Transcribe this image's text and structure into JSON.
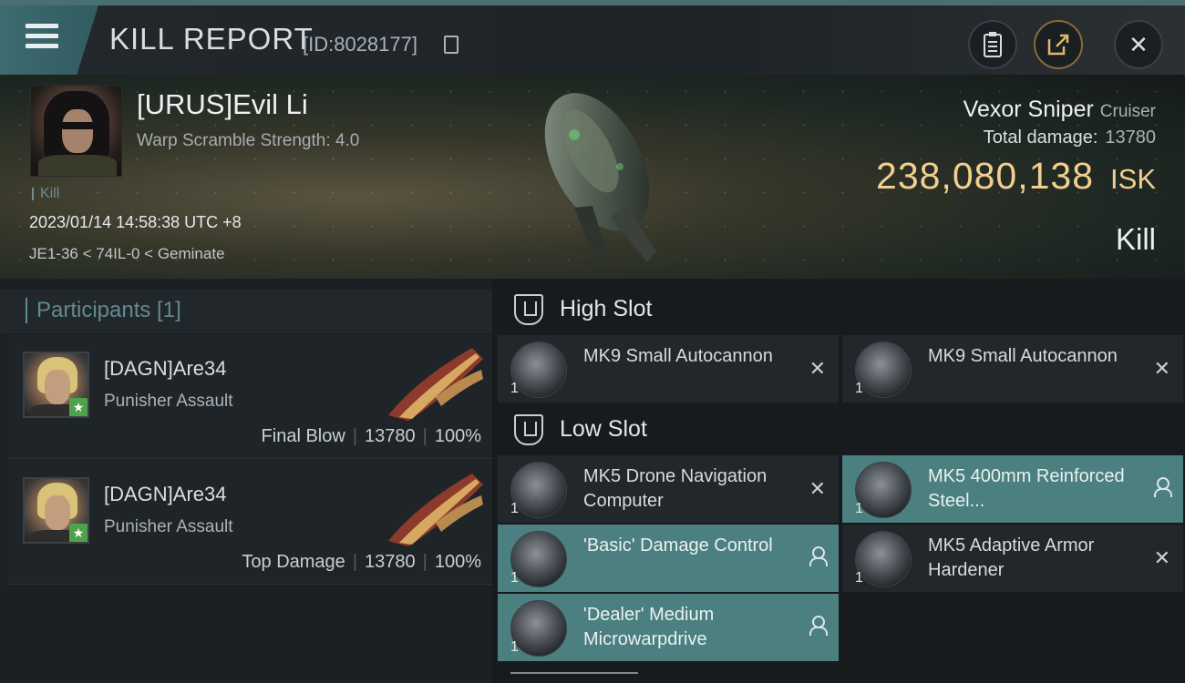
{
  "header": {
    "title": "KILL REPORT",
    "report_id": "[ID:8028177]",
    "icons": [
      "menu-icon",
      "copy-icon",
      "clipboard-icon",
      "share-icon",
      "close-icon"
    ]
  },
  "victim": {
    "name": "[URUS]Evil Li",
    "warp_scramble": "Warp Scramble Strength: 4.0",
    "kill_tag": "Kill",
    "datetime": "2023/01/14 14:58:38 UTC +8",
    "location": "JE1-36 < 74IL-0 < Geminate",
    "ship_name": "Vexor Sniper",
    "ship_class": "Cruiser",
    "total_damage_label": "Total damage:",
    "total_damage": "13780",
    "isk_value": "238,080,138",
    "isk_unit": "ISK",
    "kill_type": "Kill"
  },
  "participants": {
    "title": "Participants [1]",
    "rows": [
      {
        "name": "[DAGN]Are34",
        "ship": "Punisher Assault",
        "role": "Final Blow",
        "damage": "13780",
        "percent": "100%"
      },
      {
        "name": "[DAGN]Are34",
        "ship": "Punisher Assault",
        "role": "Top Damage",
        "damage": "13780",
        "percent": "100%"
      }
    ]
  },
  "fitting": {
    "high_slot_label": "High Slot",
    "low_slot_label": "Low Slot",
    "high": [
      {
        "name": "MK9 Small Autocannon",
        "qty": "1"
      },
      {
        "name": "MK9 Small Autocannon",
        "qty": "1"
      }
    ],
    "low": [
      {
        "name": "MK5 Drone Navigation Computer",
        "qty": "1"
      },
      {
        "name": "MK5 400mm Reinforced Steel...",
        "qty": "1"
      },
      {
        "name": "'Basic' Damage Control",
        "qty": "1"
      },
      {
        "name": "MK5 Adaptive Armor Hardener",
        "qty": "1"
      },
      {
        "name": "'Dealer' Medium Microwarpdrive",
        "qty": "1"
      }
    ]
  },
  "colors": {
    "accent": "#4c7f7f",
    "isk": "#f1cf8f",
    "header_teal": "#3c6b70"
  }
}
